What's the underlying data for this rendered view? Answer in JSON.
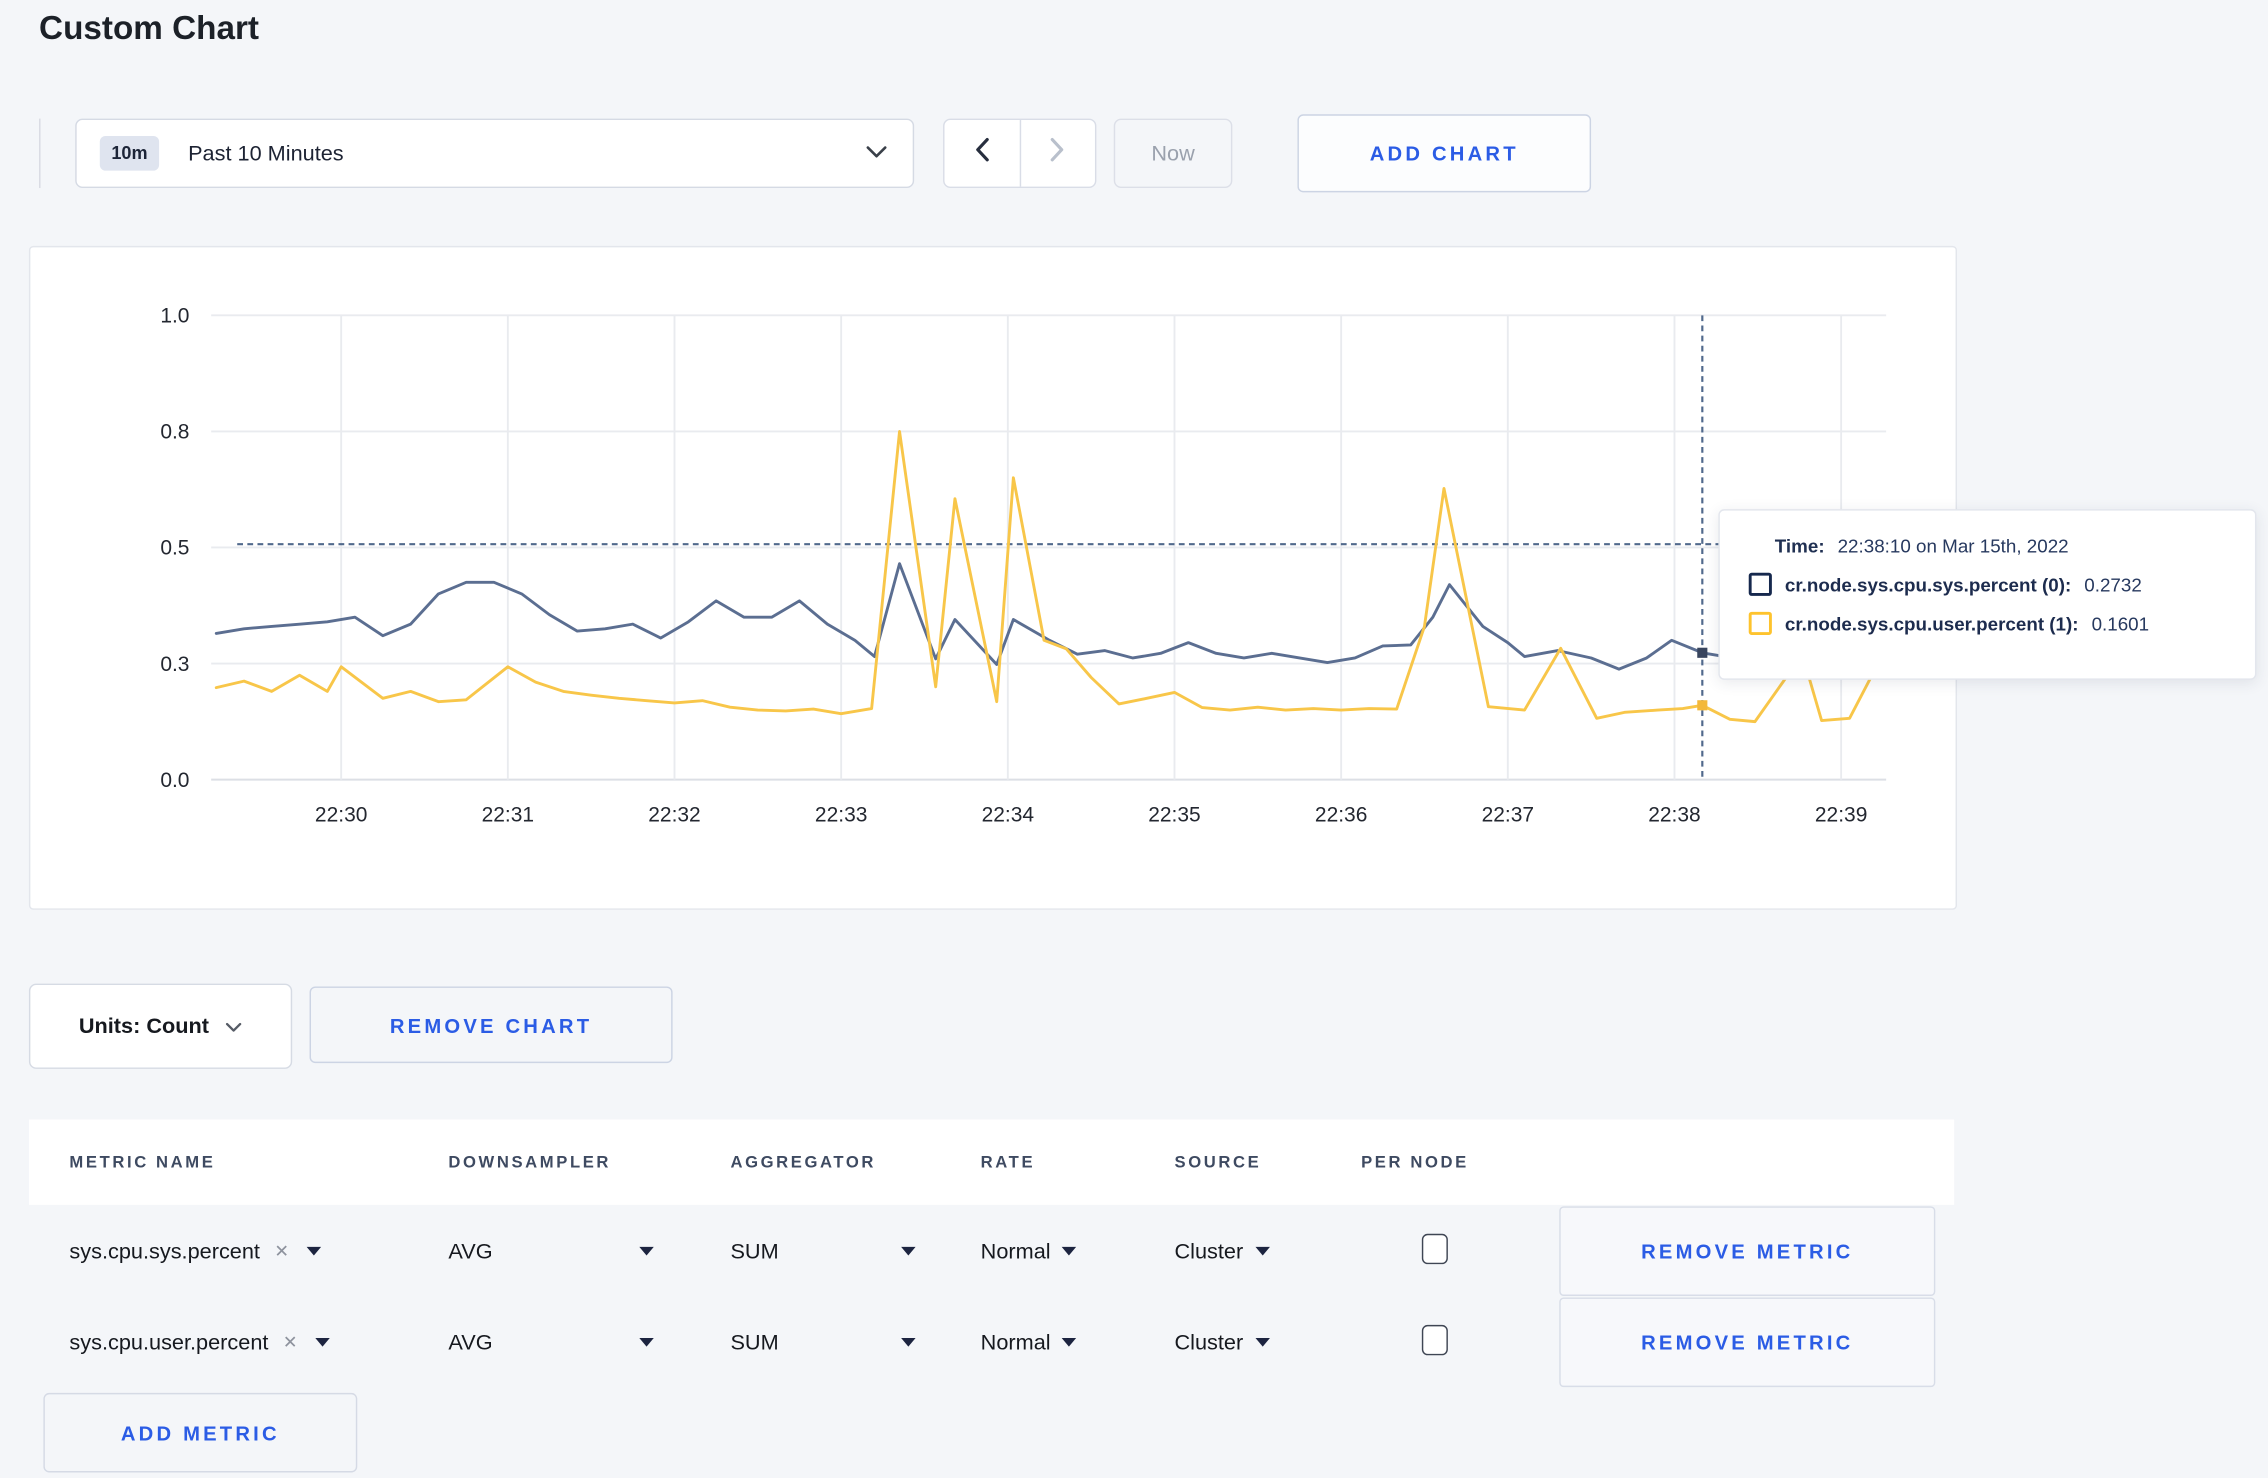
{
  "page": {
    "title": "Custom Chart"
  },
  "toolbar": {
    "time_range_badge": "10m",
    "time_range_label": "Past 10 Minutes",
    "now_label": "Now",
    "add_chart_label": "ADD CHART"
  },
  "chart": {
    "units_label": "Units: Count",
    "remove_chart_label": "REMOVE CHART",
    "tooltip": {
      "time_label": "Time:",
      "time_value": "22:38:10 on Mar 15th, 2022",
      "series": [
        {
          "label": "cr.node.sys.cpu.sys.percent (0):",
          "value": "0.2732",
          "color": "#16284d"
        },
        {
          "label": "cr.node.sys.cpu.user.percent (1):",
          "value": "0.1601",
          "color": "#fec32d"
        }
      ]
    }
  },
  "chart_data": {
    "type": "line",
    "title": "",
    "xlabel": "",
    "ylabel": "",
    "grid": true,
    "legend_position": "tooltip",
    "xlim": [
      -0.78,
      9.27
    ],
    "ylim": [
      0,
      1
    ],
    "x_ticks": [
      {
        "t": 0,
        "label": "22:30"
      },
      {
        "t": 1,
        "label": "22:31"
      },
      {
        "t": 2,
        "label": "22:32"
      },
      {
        "t": 3,
        "label": "22:33"
      },
      {
        "t": 4,
        "label": "22:34"
      },
      {
        "t": 5,
        "label": "22:35"
      },
      {
        "t": 6,
        "label": "22:36"
      },
      {
        "t": 7,
        "label": "22:37"
      },
      {
        "t": 8,
        "label": "22:38"
      },
      {
        "t": 9,
        "label": "22:39"
      }
    ],
    "y_ticks": [
      {
        "v": 0,
        "label": "0.0"
      },
      {
        "v": 0.25,
        "label": "0.3"
      },
      {
        "v": 0.5,
        "label": "0.5"
      },
      {
        "v": 0.75,
        "label": "0.8"
      },
      {
        "v": 1,
        "label": "1.0"
      }
    ],
    "guide_line_value": 0.507,
    "crosshair": {
      "t": 8.167,
      "time": "22:38:10",
      "points": [
        {
          "value": 0.2732,
          "color": "#39455e"
        },
        {
          "value": 0.1601,
          "color": "#f3b83a"
        }
      ]
    },
    "series": [
      {
        "name": "cr.node.sys.cpu.sys.percent",
        "color": "#5b6e91",
        "points": [
          [
            -0.75,
            0.315
          ],
          [
            -0.583,
            0.325
          ],
          [
            -0.417,
            0.33
          ],
          [
            -0.25,
            0.335
          ],
          [
            -0.083,
            0.34
          ],
          [
            0.083,
            0.35
          ],
          [
            0.25,
            0.31
          ],
          [
            0.417,
            0.335
          ],
          [
            0.583,
            0.4
          ],
          [
            0.75,
            0.425
          ],
          [
            0.917,
            0.425
          ],
          [
            1.083,
            0.4
          ],
          [
            1.25,
            0.355
          ],
          [
            1.417,
            0.32
          ],
          [
            1.583,
            0.325
          ],
          [
            1.75,
            0.335
          ],
          [
            1.917,
            0.305
          ],
          [
            2.083,
            0.34
          ],
          [
            2.25,
            0.385
          ],
          [
            2.417,
            0.35
          ],
          [
            2.583,
            0.35
          ],
          [
            2.75,
            0.385
          ],
          [
            2.917,
            0.335
          ],
          [
            3.083,
            0.3
          ],
          [
            3.2,
            0.265
          ],
          [
            3.35,
            0.465
          ],
          [
            3.567,
            0.26
          ],
          [
            3.683,
            0.345
          ],
          [
            3.933,
            0.248
          ],
          [
            4.033,
            0.345
          ],
          [
            4.25,
            0.3
          ],
          [
            4.417,
            0.27
          ],
          [
            4.583,
            0.278
          ],
          [
            4.75,
            0.262
          ],
          [
            4.917,
            0.272
          ],
          [
            5.083,
            0.295
          ],
          [
            5.25,
            0.272
          ],
          [
            5.417,
            0.262
          ],
          [
            5.583,
            0.272
          ],
          [
            5.75,
            0.262
          ],
          [
            5.917,
            0.252
          ],
          [
            6.083,
            0.262
          ],
          [
            6.25,
            0.288
          ],
          [
            6.417,
            0.29
          ],
          [
            6.55,
            0.35
          ],
          [
            6.65,
            0.42
          ],
          [
            6.85,
            0.33
          ],
          [
            7.0,
            0.295
          ],
          [
            7.1,
            0.265
          ],
          [
            7.3,
            0.278
          ],
          [
            7.5,
            0.262
          ],
          [
            7.667,
            0.238
          ],
          [
            7.833,
            0.262
          ],
          [
            7.983,
            0.3
          ],
          [
            8.167,
            0.2732
          ],
          [
            8.35,
            0.262
          ],
          [
            8.55,
            0.272
          ],
          [
            8.75,
            0.285
          ],
          [
            8.95,
            0.295
          ],
          [
            9.1,
            0.3
          ],
          [
            9.2,
            0.305
          ]
        ]
      },
      {
        "name": "cr.node.sys.cpu.user.percent",
        "color": "#f8c649",
        "points": [
          [
            -0.75,
            0.198
          ],
          [
            -0.583,
            0.212
          ],
          [
            -0.417,
            0.19
          ],
          [
            -0.25,
            0.225
          ],
          [
            -0.083,
            0.19
          ],
          [
            0.0,
            0.243
          ],
          [
            0.25,
            0.175
          ],
          [
            0.417,
            0.19
          ],
          [
            0.583,
            0.168
          ],
          [
            0.75,
            0.172
          ],
          [
            1.0,
            0.243
          ],
          [
            1.167,
            0.21
          ],
          [
            1.333,
            0.19
          ],
          [
            1.5,
            0.182
          ],
          [
            1.667,
            0.175
          ],
          [
            1.833,
            0.17
          ],
          [
            2.0,
            0.165
          ],
          [
            2.167,
            0.17
          ],
          [
            2.333,
            0.156
          ],
          [
            2.5,
            0.15
          ],
          [
            2.667,
            0.148
          ],
          [
            2.833,
            0.152
          ],
          [
            3.0,
            0.142
          ],
          [
            3.183,
            0.153
          ],
          [
            3.35,
            0.75
          ],
          [
            3.567,
            0.2
          ],
          [
            3.683,
            0.605
          ],
          [
            3.933,
            0.168
          ],
          [
            4.033,
            0.65
          ],
          [
            4.217,
            0.3
          ],
          [
            4.35,
            0.282
          ],
          [
            4.5,
            0.22
          ],
          [
            4.667,
            0.163
          ],
          [
            4.833,
            0.175
          ],
          [
            5.0,
            0.188
          ],
          [
            5.167,
            0.155
          ],
          [
            5.333,
            0.15
          ],
          [
            5.5,
            0.156
          ],
          [
            5.667,
            0.15
          ],
          [
            5.833,
            0.153
          ],
          [
            6.0,
            0.15
          ],
          [
            6.167,
            0.153
          ],
          [
            6.333,
            0.152
          ],
          [
            6.5,
            0.33
          ],
          [
            6.617,
            0.627
          ],
          [
            6.883,
            0.157
          ],
          [
            7.1,
            0.15
          ],
          [
            7.317,
            0.283
          ],
          [
            7.533,
            0.132
          ],
          [
            7.7,
            0.145
          ],
          [
            7.9,
            0.15
          ],
          [
            8.05,
            0.153
          ],
          [
            8.167,
            0.1601
          ],
          [
            8.333,
            0.13
          ],
          [
            8.483,
            0.125
          ],
          [
            8.65,
            0.21
          ],
          [
            8.767,
            0.27
          ],
          [
            8.883,
            0.127
          ],
          [
            9.05,
            0.132
          ],
          [
            9.2,
            0.235
          ]
        ]
      }
    ]
  },
  "metrics_table": {
    "headers": [
      "METRIC NAME",
      "DOWNSAMPLER",
      "AGGREGATOR",
      "RATE",
      "SOURCE",
      "PER NODE"
    ],
    "rows": [
      {
        "metric_name": "sys.cpu.sys.percent",
        "downsampler": "AVG",
        "aggregator": "SUM",
        "rate": "Normal",
        "source": "Cluster",
        "per_node_checked": false,
        "remove_label": "REMOVE METRIC"
      },
      {
        "metric_name": "sys.cpu.user.percent",
        "downsampler": "AVG",
        "aggregator": "SUM",
        "rate": "Normal",
        "source": "Cluster",
        "per_node_checked": false,
        "remove_label": "REMOVE METRIC"
      }
    ],
    "add_metric_label": "ADD METRIC"
  }
}
